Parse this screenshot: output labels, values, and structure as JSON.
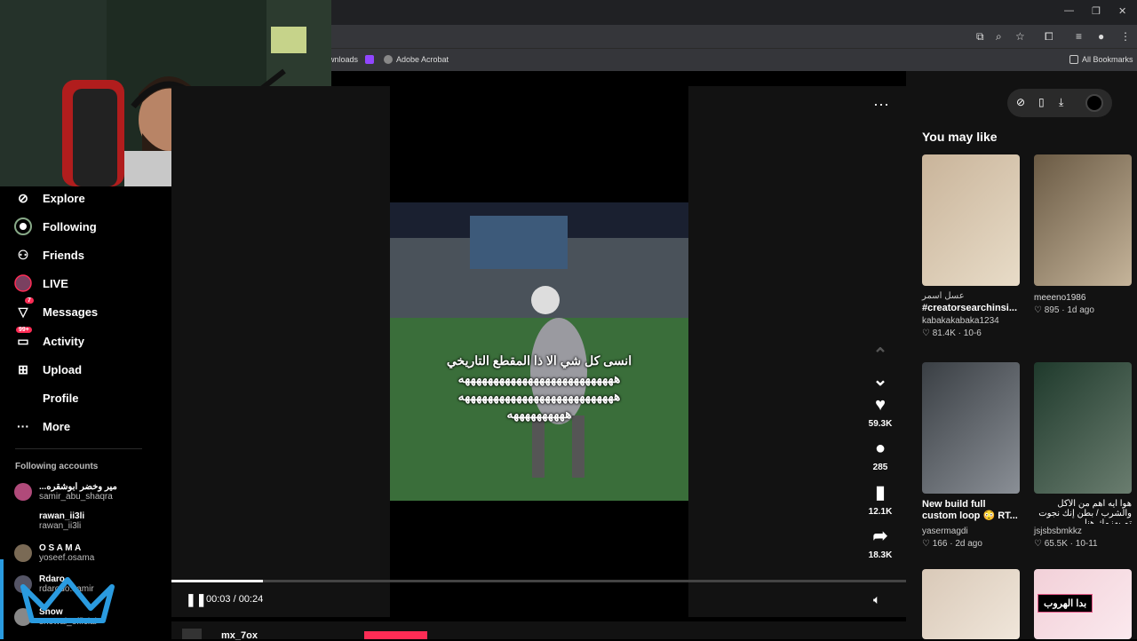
{
  "browser": {
    "bookmarks": [
      {
        "label": "wnloads",
        "color": "#666"
      },
      {
        "label": "",
        "color": "#9146ff"
      },
      {
        "label": "Adobe Acrobat",
        "color": "#888"
      }
    ],
    "all_bookmarks": "All Bookmarks"
  },
  "sidebar": {
    "items": [
      {
        "label": "Explore",
        "icon": "compass"
      },
      {
        "label": "Following",
        "icon": "following"
      },
      {
        "label": "Friends",
        "icon": "friends"
      },
      {
        "label": "LIVE",
        "icon": "live"
      },
      {
        "label": "Messages",
        "icon": "messages",
        "badge": "7"
      },
      {
        "label": "Activity",
        "icon": "activity",
        "badge": "99+"
      },
      {
        "label": "Upload",
        "icon": "upload"
      },
      {
        "label": "Profile",
        "icon": "profile"
      },
      {
        "label": "More",
        "icon": "more"
      }
    ],
    "following_title": "Following accounts",
    "accounts": [
      {
        "name": "...مير وخضر ابوشقره",
        "handle": "samir_abu_shaqra"
      },
      {
        "name": "rawan_ii3li",
        "handle": "rawan_ii3li"
      },
      {
        "name": "O S A M A",
        "handle": "yoseef.osama"
      },
      {
        "name": "Rdaro",
        "handle": "rdarodo.samir"
      },
      {
        "name": "Snow",
        "handle": "snowai_official"
      }
    ]
  },
  "video": {
    "caption_line1": "انسى كل شي الا ذا المقطع التاريخي",
    "caption_line2": "هههههههههههههههههههههههههههه",
    "caption_line3": "هههههههههههههههههههههههههههه",
    "caption_line4": "ههههههههههه",
    "time": "00:03 / 00:24",
    "progress": 0.125,
    "likes": "59.3K",
    "comments": "285",
    "saves": "12.1K",
    "shares": "18.3K",
    "author": "mx_7ox"
  },
  "recommend": {
    "title": "You may like",
    "cards": [
      {
        "title_ar": "عسل اسمر",
        "title": "#creatorsearchinsi...",
        "author": "kabakakabaka1234",
        "meta": "♡ 81.4K · 10-6",
        "colors": [
          "#c9b49a",
          "#e8dcc8"
        ]
      },
      {
        "title_ar": "",
        "title": "meeeno1986",
        "author": "",
        "meta": "♡ 895 · 1d ago",
        "colors": [
          "#6a5a44",
          "#c5b49a"
        ]
      },
      {
        "title_ar": "",
        "title": "New build full custom loop 😳 RT...",
        "author": "yasermagdi",
        "meta": "♡ 166 · 2d ago",
        "colors": [
          "#3a3f44",
          "#8a8f96"
        ]
      },
      {
        "title_ar": "",
        "title": "هوا ايه اهم من الأكل والشرب / بطن إنك نجوت تم يهزمك هنا",
        "author": "jsjsbsbmkkz",
        "meta": "♡ 65.5K · 10-11",
        "colors": [
          "#1f3a2c",
          "#6a7d6f"
        ]
      },
      {
        "title_ar": "",
        "title": "",
        "author": "",
        "meta": "",
        "colors": [
          "#d9c9b8",
          "#f0e6da"
        ]
      },
      {
        "title_ar": "",
        "title": "بدا الهروب",
        "author": "",
        "meta": "",
        "colors": [
          "#f2d0d8",
          "#fbe9ee"
        ]
      }
    ]
  }
}
